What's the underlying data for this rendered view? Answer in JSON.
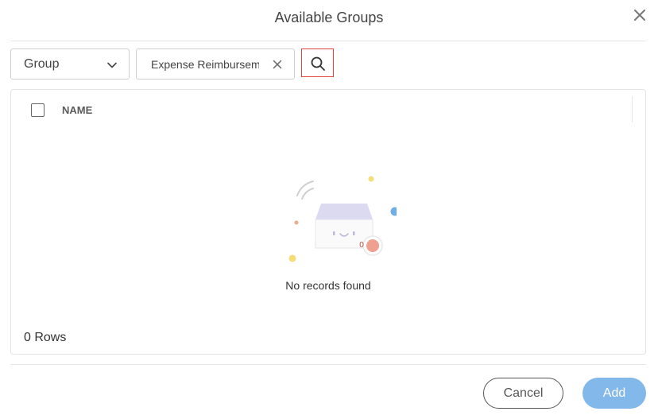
{
  "dialog": {
    "title": "Available Groups",
    "close_icon": "close-icon"
  },
  "filter": {
    "select_value": "Group",
    "search_value": "Expense Reimbursem",
    "clear_icon": "clear-icon",
    "search_icon": "search-icon"
  },
  "grid": {
    "columns": [
      {
        "label": "NAME"
      }
    ],
    "empty_message": "No records found",
    "empty_badge": "0",
    "rows_label": "0 Rows"
  },
  "footer": {
    "cancel_label": "Cancel",
    "add_label": "Add"
  },
  "colors": {
    "accent": "#82b8ea",
    "highlight_border": "#e0443b"
  }
}
